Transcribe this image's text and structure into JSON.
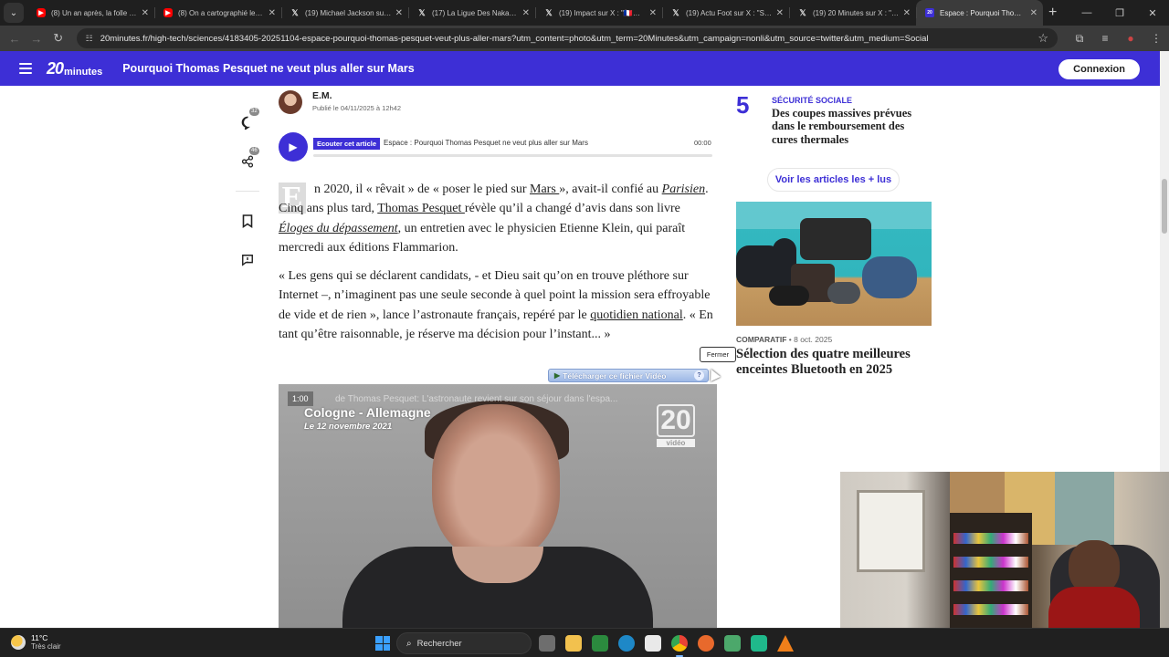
{
  "browser": {
    "tab_menu_icon": "chevron-down-icon",
    "tabs": [
      {
        "label": "(8) Un an après, la folle h…",
        "icon": "youtube",
        "active": false
      },
      {
        "label": "(8) On a cartographié les …",
        "icon": "youtube",
        "active": false
      },
      {
        "label": "(19) Michael Jackson sur X…",
        "icon": "x",
        "active": false
      },
      {
        "label": "(17) La Ligue Des Nakam…",
        "icon": "x",
        "active": false
      },
      {
        "label": "(19) Impact sur X : \"🇫🇷🔍…",
        "icon": "x",
        "active": false
      },
      {
        "label": "(19) Actu Foot sur X : \"STA…",
        "icon": "x",
        "active": false
      },
      {
        "label": "(19) 20 Minutes sur X : \"…",
        "icon": "x",
        "active": false
      },
      {
        "label": "Espace : Pourquoi Thoma…",
        "icon": "20minutes",
        "active": true
      }
    ],
    "url": "20minutes.fr/high-tech/sciences/4183405-20251104-espace-pourquoi-thomas-pesquet-veut-plus-aller-mars?utm_content=photo&utm_term=20Minutes&utm_campaign=nonli&utm_source=twitter&utm_medium=Social"
  },
  "site": {
    "logo_number": "20",
    "logo_word": "minutes",
    "header_title": "Pourquoi Thomas Pesquet ne veut plus aller sur Mars",
    "login_label": "Connexion",
    "accent_color": "#3d2fd6"
  },
  "rail": {
    "comments_count": "32",
    "share_count": "46"
  },
  "article": {
    "author": "E.M.",
    "published": "Publié le 04/11/2025 à 12h42",
    "listen_label": "Ecouter cet article",
    "audio_title": "Espace : Pourquoi Thomas Pesquet ne veut plus aller sur Mars",
    "audio_time": "00:00",
    "dropcap": "E",
    "p1": {
      "t1": "n 2020, il « rêvait » de « poser le pied sur ",
      "link1": "Mars ",
      "t2": "», avait-il confié au ",
      "link2": "Parisien",
      "t3": ". Cinq ans plus tard, ",
      "link3": "Thomas Pesquet ",
      "t4": "révèle qu’il a changé d’avis dans son livre ",
      "book": "Éloges du dépassement",
      "t5": ", un entretien avec le physicien Etienne Klein, qui paraît mercredi aux éditions Flammarion."
    },
    "p2": {
      "t1": "« Les gens qui se déclarent candidats, - et Dieu sait qu’on en trouve pléthore sur Internet –, n’imaginent pas une seule seconde à quel point la mission sera effroyable de vide et de rien », lance l’astronaute français, repéré par le ",
      "link": "quotidien national",
      "t2": ". « En tant qu’être raisonnable, je réserve ma décision pour l’instant... »"
    },
    "download_label": "Télécharger ce fichier Vidéo",
    "download_help": "?",
    "tooltip_close": "Fermer",
    "video": {
      "timecode": "1:00",
      "title": "de Thomas Pesquet: L'astronaute revient sur son séjour dans l'espa...",
      "place": "Cologne - Allemagne",
      "date": "Le 12 novembre 2021",
      "watermark_number": "20",
      "watermark_word": "vidéo"
    }
  },
  "sidebar": {
    "rank": "5",
    "category": "SÉCURITÉ SOCIALE",
    "title": "Des coupes massives prévues dans le remboursement des cures thermales",
    "more_label": "Voir les articles les + lus",
    "card": {
      "category": "COMPARATIF",
      "date": "• 8 oct. 2025",
      "title": "Sélection des quatre meilleures enceintes Bluetooth en 2025"
    }
  },
  "taskbar": {
    "temperature": "11°C",
    "weather": "Très clair",
    "search_label": "Rechercher"
  }
}
